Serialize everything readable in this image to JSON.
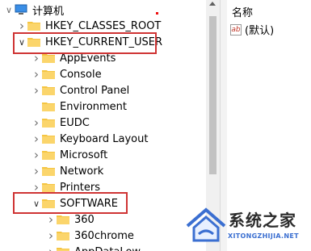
{
  "tree": {
    "root_label": "计算机",
    "items": [
      {
        "label": "HKEY_CLASSES_ROOT",
        "expander": "collapsed"
      },
      {
        "label": "HKEY_CURRENT_USER",
        "expander": "expanded",
        "highlighted": true
      },
      {
        "label": "AppEvents",
        "expander": "collapsed"
      },
      {
        "label": "Console",
        "expander": "collapsed"
      },
      {
        "label": "Control Panel",
        "expander": "collapsed"
      },
      {
        "label": "Environment",
        "expander": "none"
      },
      {
        "label": "EUDC",
        "expander": "collapsed"
      },
      {
        "label": "Keyboard Layout",
        "expander": "collapsed"
      },
      {
        "label": "Microsoft",
        "expander": "collapsed"
      },
      {
        "label": "Network",
        "expander": "collapsed"
      },
      {
        "label": "Printers",
        "expander": "collapsed"
      },
      {
        "label": "SOFTWARE",
        "expander": "expanded",
        "highlighted": true
      },
      {
        "label": "360",
        "expander": "collapsed"
      },
      {
        "label": "360chrome",
        "expander": "collapsed"
      },
      {
        "label": "AppDataLow",
        "expander": "collapsed"
      }
    ]
  },
  "values": {
    "column_header": "名称",
    "default_value": "(默认)",
    "ab_icon_text": "ab"
  },
  "watermark": {
    "title": "系统之家",
    "url": "XITONGZHIJIA.NET"
  },
  "colors": {
    "folder": "#f5c542",
    "highlight_box": "#cf3434",
    "watermark_blue": "#3b6fd1"
  }
}
